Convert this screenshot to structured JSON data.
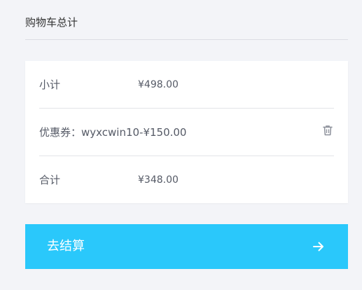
{
  "title": "购物车总计",
  "summary": {
    "subtotal_label": "小计",
    "subtotal_value": "¥498.00",
    "coupon_label": "优惠券：wyxcwin10-¥150.00",
    "coupon_icon": "trash-icon",
    "total_label": "合计",
    "total_value": "¥348.00"
  },
  "checkout": {
    "label": "去结算",
    "icon": "arrow-right-icon"
  },
  "colors": {
    "background": "#f3f4f8",
    "card": "#ffffff",
    "accent": "#2ac8fb",
    "text": "#555a66"
  }
}
